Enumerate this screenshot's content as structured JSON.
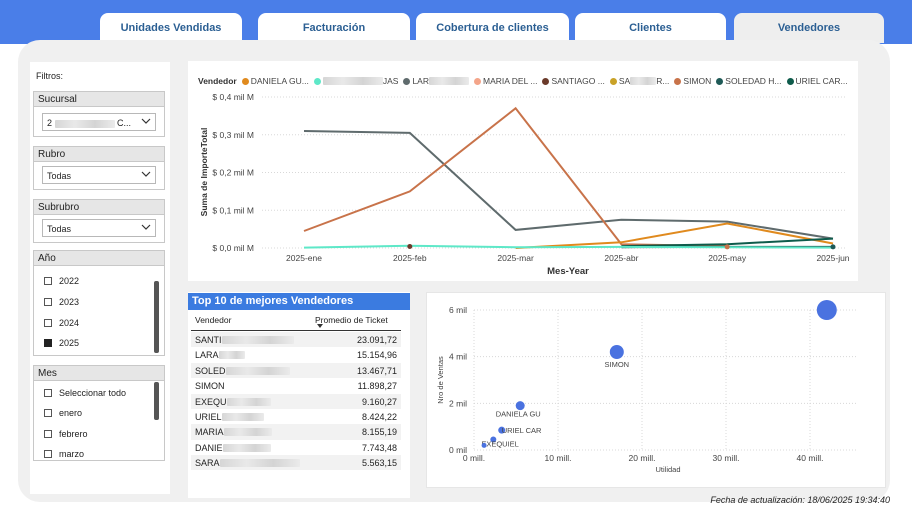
{
  "tabs": [
    {
      "label": "Unidades Vendidas",
      "active": false
    },
    {
      "label": "Facturación",
      "active": false
    },
    {
      "label": "Cobertura de clientes",
      "active": false
    },
    {
      "label": "Clientes",
      "active": false
    },
    {
      "label": "Vendedores",
      "active": true
    }
  ],
  "filters": {
    "title": "Filtros:",
    "sucursal": {
      "label": "Sucursal",
      "value_prefix": "2",
      "value_suffix": "C..."
    },
    "rubro": {
      "label": "Rubro",
      "value": "Todas"
    },
    "subrubro": {
      "label": "Subrubro",
      "value": "Todas"
    },
    "anio": {
      "label": "Año",
      "options": [
        {
          "label": "2022",
          "checked": false
        },
        {
          "label": "2023",
          "checked": false
        },
        {
          "label": "2024",
          "checked": false
        },
        {
          "label": "2025",
          "checked": true
        }
      ]
    },
    "mes": {
      "label": "Mes",
      "options": [
        {
          "label": "Seleccionar todo",
          "checked": false
        },
        {
          "label": "enero",
          "checked": false
        },
        {
          "label": "febrero",
          "checked": false
        },
        {
          "label": "marzo",
          "checked": false
        }
      ]
    }
  },
  "line_chart": {
    "legend_title": "Vendedor",
    "legend": [
      {
        "name": "DANIELA GU...",
        "color": "#e08a1e"
      },
      {
        "name": "",
        "color": "#5ee8c8",
        "suffix": "JAS"
      },
      {
        "name": "LAR",
        "color": "#5f6b6d"
      },
      {
        "name": "MARIA DEL ...",
        "color": "#f4a58a"
      },
      {
        "name": "SANTIAGO ...",
        "color": "#6b3a2a"
      },
      {
        "name": "SA",
        "color": "#c9a227",
        "suffix": "R..."
      },
      {
        "name": "SIMON",
        "color": "#c8734a"
      },
      {
        "name": "SOLEDAD H...",
        "color": "#1f5a57"
      },
      {
        "name": "URIEL CAR...",
        "color": "#0e5b4b"
      }
    ]
  },
  "top10": {
    "title": "Top 10 de mejores Vendedores",
    "col_vendedor": "Vendedor",
    "col_promedio": "Promedio de Ticket",
    "rows": [
      {
        "name": "SANTI",
        "value": "23.091,72"
      },
      {
        "name": "LARA",
        "value": "15.154,96"
      },
      {
        "name": "SOLED",
        "value": "13.467,71"
      },
      {
        "name": "SIMON",
        "value": "11.898,27"
      },
      {
        "name": "EXEQU",
        "value": "9.160,27"
      },
      {
        "name": "URIEL",
        "value": "8.424,22"
      },
      {
        "name": "MARIA",
        "value": "8.155,19"
      },
      {
        "name": "DANIE",
        "value": "7.743,48"
      },
      {
        "name": "SARA",
        "value": "5.563,15"
      }
    ]
  },
  "footer": "Fecha de actualización: 18/06/2025 19:34:40",
  "chart_data": [
    {
      "type": "line",
      "xlabel": "Mes-Year",
      "ylabel": "Suma de ImporteTotal",
      "categories": [
        "2025-ene",
        "2025-feb",
        "2025-mar",
        "2025-abr",
        "2025-may",
        "2025-jun"
      ],
      "y_ticks": [
        "$ 0,0 mil M",
        "$ 0,1 mil M",
        "$ 0,2 mil M",
        "$ 0,3 mil M",
        "$ 0,4 mil M"
      ],
      "ylim": [
        0,
        0.4
      ],
      "series": [
        {
          "name": "LAR",
          "color": "#5f6b6d",
          "values": [
            0.31,
            0.305,
            0.048,
            0.075,
            0.07,
            0.025
          ]
        },
        {
          "name": "SIMON",
          "color": "#c8734a",
          "values": [
            0.045,
            0.15,
            0.37,
            0.01,
            0.005,
            null
          ]
        },
        {
          "name": "DANIELA GU...",
          "color": "#e08a1e",
          "values": [
            null,
            null,
            0.0,
            0.015,
            0.065,
            0.012
          ]
        },
        {
          "name": "URIEL CAR...",
          "color": "#0e5b4b",
          "values": [
            null,
            null,
            null,
            0.005,
            0.01,
            0.025
          ]
        },
        {
          "name": "SOLEDAD H...",
          "color": "#1f5a57",
          "values": [
            null,
            null,
            null,
            0.002,
            0.003,
            0.003
          ]
        },
        {
          "name": "",
          "color": "#5ee8c8",
          "values": [
            0.001,
            0.006,
            0.002,
            0.003,
            0.002,
            0.001
          ]
        }
      ]
    },
    {
      "type": "scatter",
      "xlabel": "Utilidad",
      "ylabel": "Nro de Ventas",
      "x_ticks": [
        "0 mill.",
        "10 mill.",
        "20 mill.",
        "30 mill.",
        "40 mill."
      ],
      "y_ticks": [
        "0 mil",
        "2 mil",
        "4 mil",
        "6 mil"
      ],
      "xlim": [
        0,
        45
      ],
      "ylim": [
        0,
        6.5
      ],
      "points": [
        {
          "label": "",
          "x": 42,
          "y": 6.0,
          "size": 10
        },
        {
          "label": "SIMON",
          "x": 17,
          "y": 4.2,
          "size": 7
        },
        {
          "label": "DANIELA GU",
          "x": 5.5,
          "y": 1.9,
          "size": 4.5
        },
        {
          "label": "URIEL CAR",
          "x": 3.3,
          "y": 0.85,
          "size": 3.5
        },
        {
          "label": "EXEQUIEL",
          "x": 2.3,
          "y": 0.45,
          "size": 3
        },
        {
          "label": "",
          "x": 1.2,
          "y": 0.2,
          "size": 2.5
        }
      ]
    }
  ]
}
